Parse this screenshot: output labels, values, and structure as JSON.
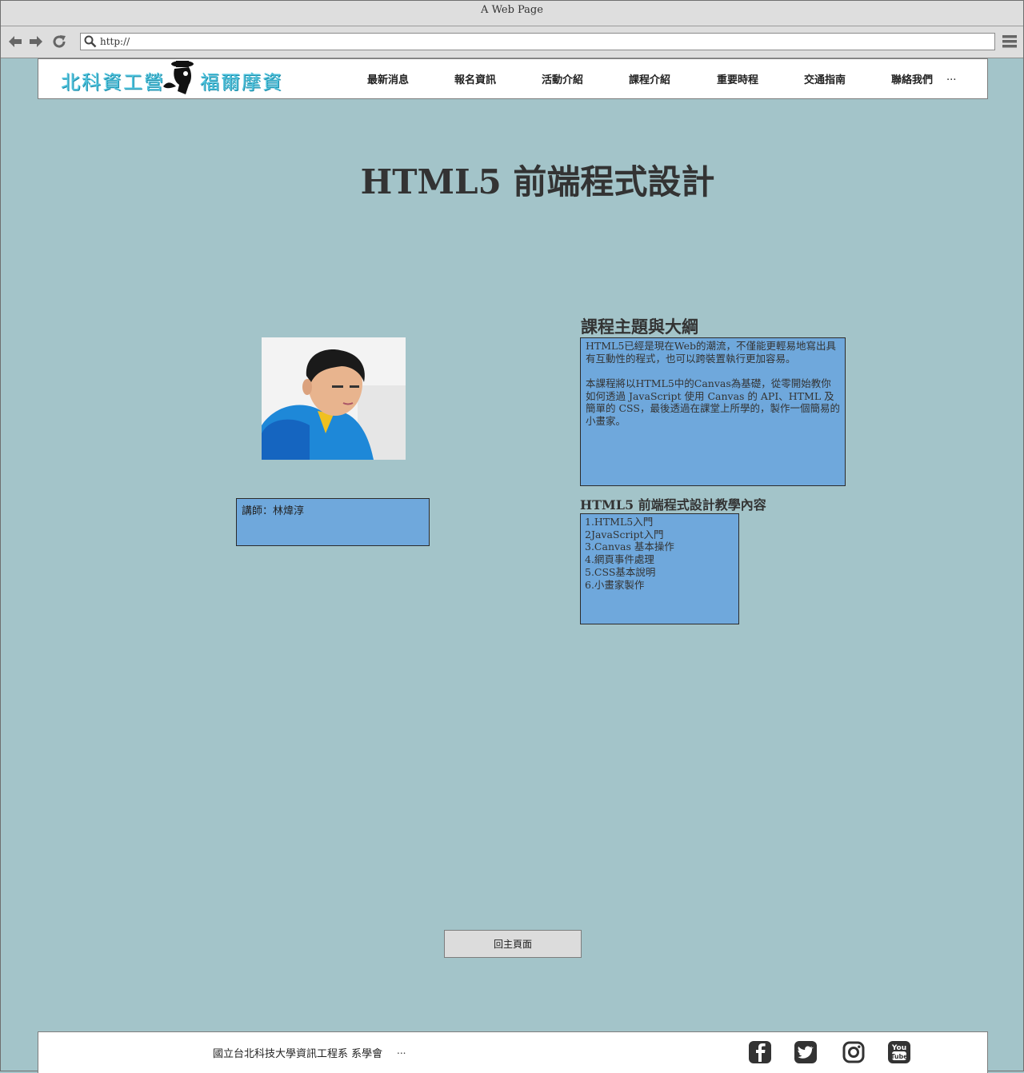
{
  "browser": {
    "window_title": "A Web Page",
    "url_value": "http://"
  },
  "header": {
    "logo_left": "北科資工營",
    "logo_right": "福爾摩資",
    "nav": [
      "最新消息",
      "報名資訊",
      "活動介紹",
      "課程介紹",
      "重要時程",
      "交通指南",
      "聯絡我們"
    ],
    "more": "..."
  },
  "main": {
    "title": "HTML5 前端程式設計",
    "teacher": "講師：林煒淳",
    "topic_title": "課程主題與大綱",
    "description": [
      "HTML5已經是現在Web的潮流，不僅能更輕易地寫出具有互動性的程式，也可以跨裝置執行更加容易。",
      "本課程將以HTML5中的Canvas為基礎，從零開始教你如何透過 JavaScript 使用 Canvas 的 API、HTML 及簡單的 CSS，最後透過在課堂上所學的，製作一個簡易的小畫家。"
    ],
    "content_title": "HTML5 前端程式設計教學內容",
    "content_items": [
      "1.HTML5入門",
      "2JavaScript入門",
      "3.Canvas 基本操作",
      "4.網頁事件處理",
      "5.CSS基本說明",
      "6.小畫家製作"
    ],
    "home_button": "回主頁面"
  },
  "footer": {
    "text": "國立台北科技大學資訊工程系 系學會",
    "more": "...",
    "social": [
      "facebook-icon",
      "twitter-icon",
      "instagram-icon",
      "youtube-icon"
    ]
  },
  "colors": {
    "page_bg": "#a3c4c9",
    "box_bg": "#6fa8dc",
    "logo_accent": "#4fc3dd"
  }
}
